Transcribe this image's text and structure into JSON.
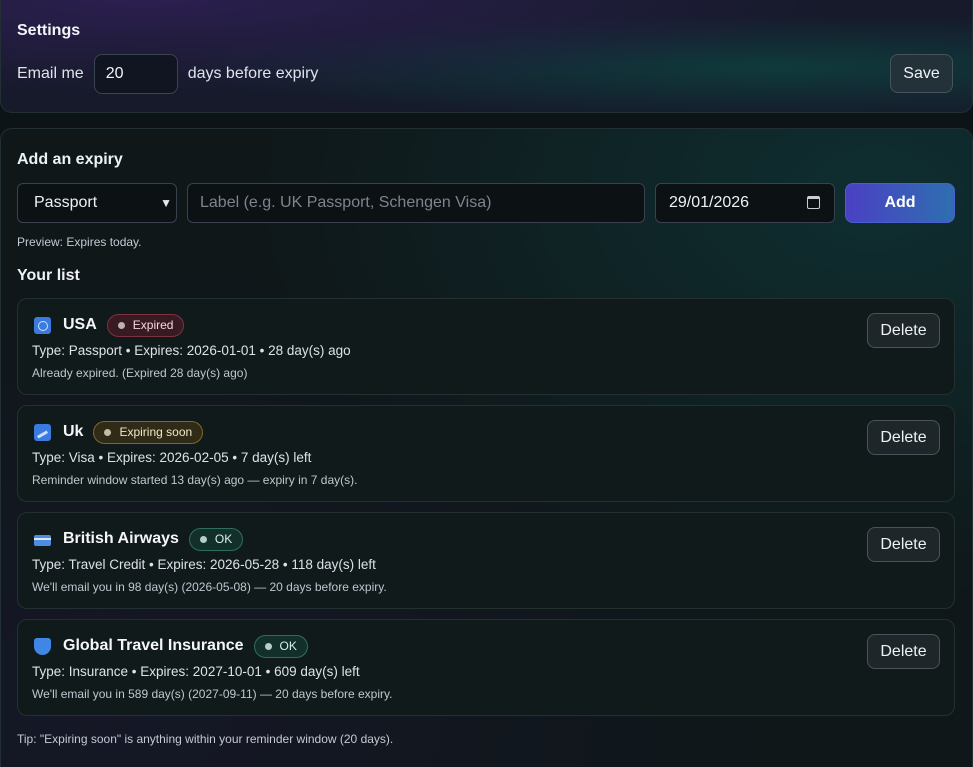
{
  "settings": {
    "title": "Settings",
    "email_prefix": "Email me",
    "days_value": "20",
    "email_suffix": "days before expiry",
    "save_label": "Save"
  },
  "add": {
    "title": "Add an expiry",
    "type_selected": "Passport",
    "label_placeholder": "Label (e.g. UK Passport, Schengen Visa)",
    "date_value": "29/01/2026",
    "add_label": "Add",
    "preview": "Preview: Expires today."
  },
  "list": {
    "title": "Your list",
    "delete_label": "Delete",
    "items": [
      {
        "icon": "passport-icon",
        "name": "USA",
        "status": "Expired",
        "meta": "Type: Passport • Expires: 2026-01-01 • 28 day(s) ago",
        "note": "Already expired. (Expired 28 day(s) ago)"
      },
      {
        "icon": "visa-icon",
        "name": "Uk",
        "status": "Expiring soon",
        "meta": "Type: Visa • Expires: 2026-02-05 • 7 day(s) left",
        "note": "Reminder window started 13 day(s) ago — expiry in 7 day(s)."
      },
      {
        "icon": "credit-card-icon",
        "name": "British Airways",
        "status": "OK",
        "meta": "Type: Travel Credit • Expires: 2026-05-28 • 118 day(s) left",
        "note": "We'll email you in 98 day(s) (2026-05-08) — 20 days before expiry."
      },
      {
        "icon": "shield-icon",
        "name": "Global Travel Insurance",
        "status": "OK",
        "meta": "Type: Insurance • Expires: 2027-10-01 • 609 day(s) left",
        "note": "We'll email you in 589 day(s) (2027-09-11) — 20 days before expiry."
      }
    ]
  },
  "tip": "Tip: \"Expiring soon\" is anything within your reminder window (20 days).",
  "colors": {
    "accent_gradient_start": "#4a40c4",
    "accent_gradient_end": "#2e6fb0",
    "expired": "#7a3340",
    "expiring_soon": "#7a6a26",
    "ok": "#2e6f5c"
  }
}
